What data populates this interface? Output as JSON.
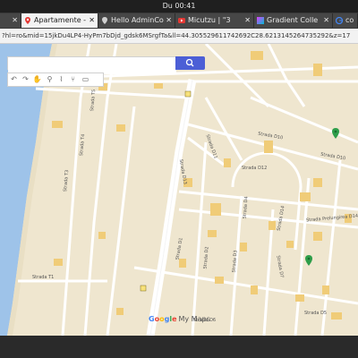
{
  "system": {
    "clock": "Du 00:41"
  },
  "tabs": [
    {
      "label": ""
    },
    {
      "label": "Apartamente -"
    },
    {
      "label": "Hello AdminCo"
    },
    {
      "label": "Micutzu | \"3"
    },
    {
      "label": "Gradient Colle"
    },
    {
      "label": "co"
    }
  ],
  "address": {
    "value": "?hl=ro&mid=15jkDu4LP4-HyPm7bDjd_gdsk6MSrgfTa&ll=44.305529611742692C28.6213145264735292&z=17"
  },
  "map": {
    "search_placeholder": "",
    "logo": {
      "g1": "G",
      "o1": "o",
      "o2": "o",
      "g2": "g",
      "l": "l",
      "e": "e",
      "suffix": "My Maps"
    },
    "street_labels": [
      "Strada D10",
      "Strada D10",
      "Strada D11",
      "Strada D12",
      "Strada D13",
      "Strada D14",
      "Strada Prelungirea D14",
      "Strada D1",
      "Strada D2",
      "Strada D3",
      "Strada D4",
      "Strada D5",
      "Strada D6",
      "Strada D7",
      "Strada T1",
      "Strada T3",
      "Strada T4",
      "Strada T5"
    ]
  }
}
